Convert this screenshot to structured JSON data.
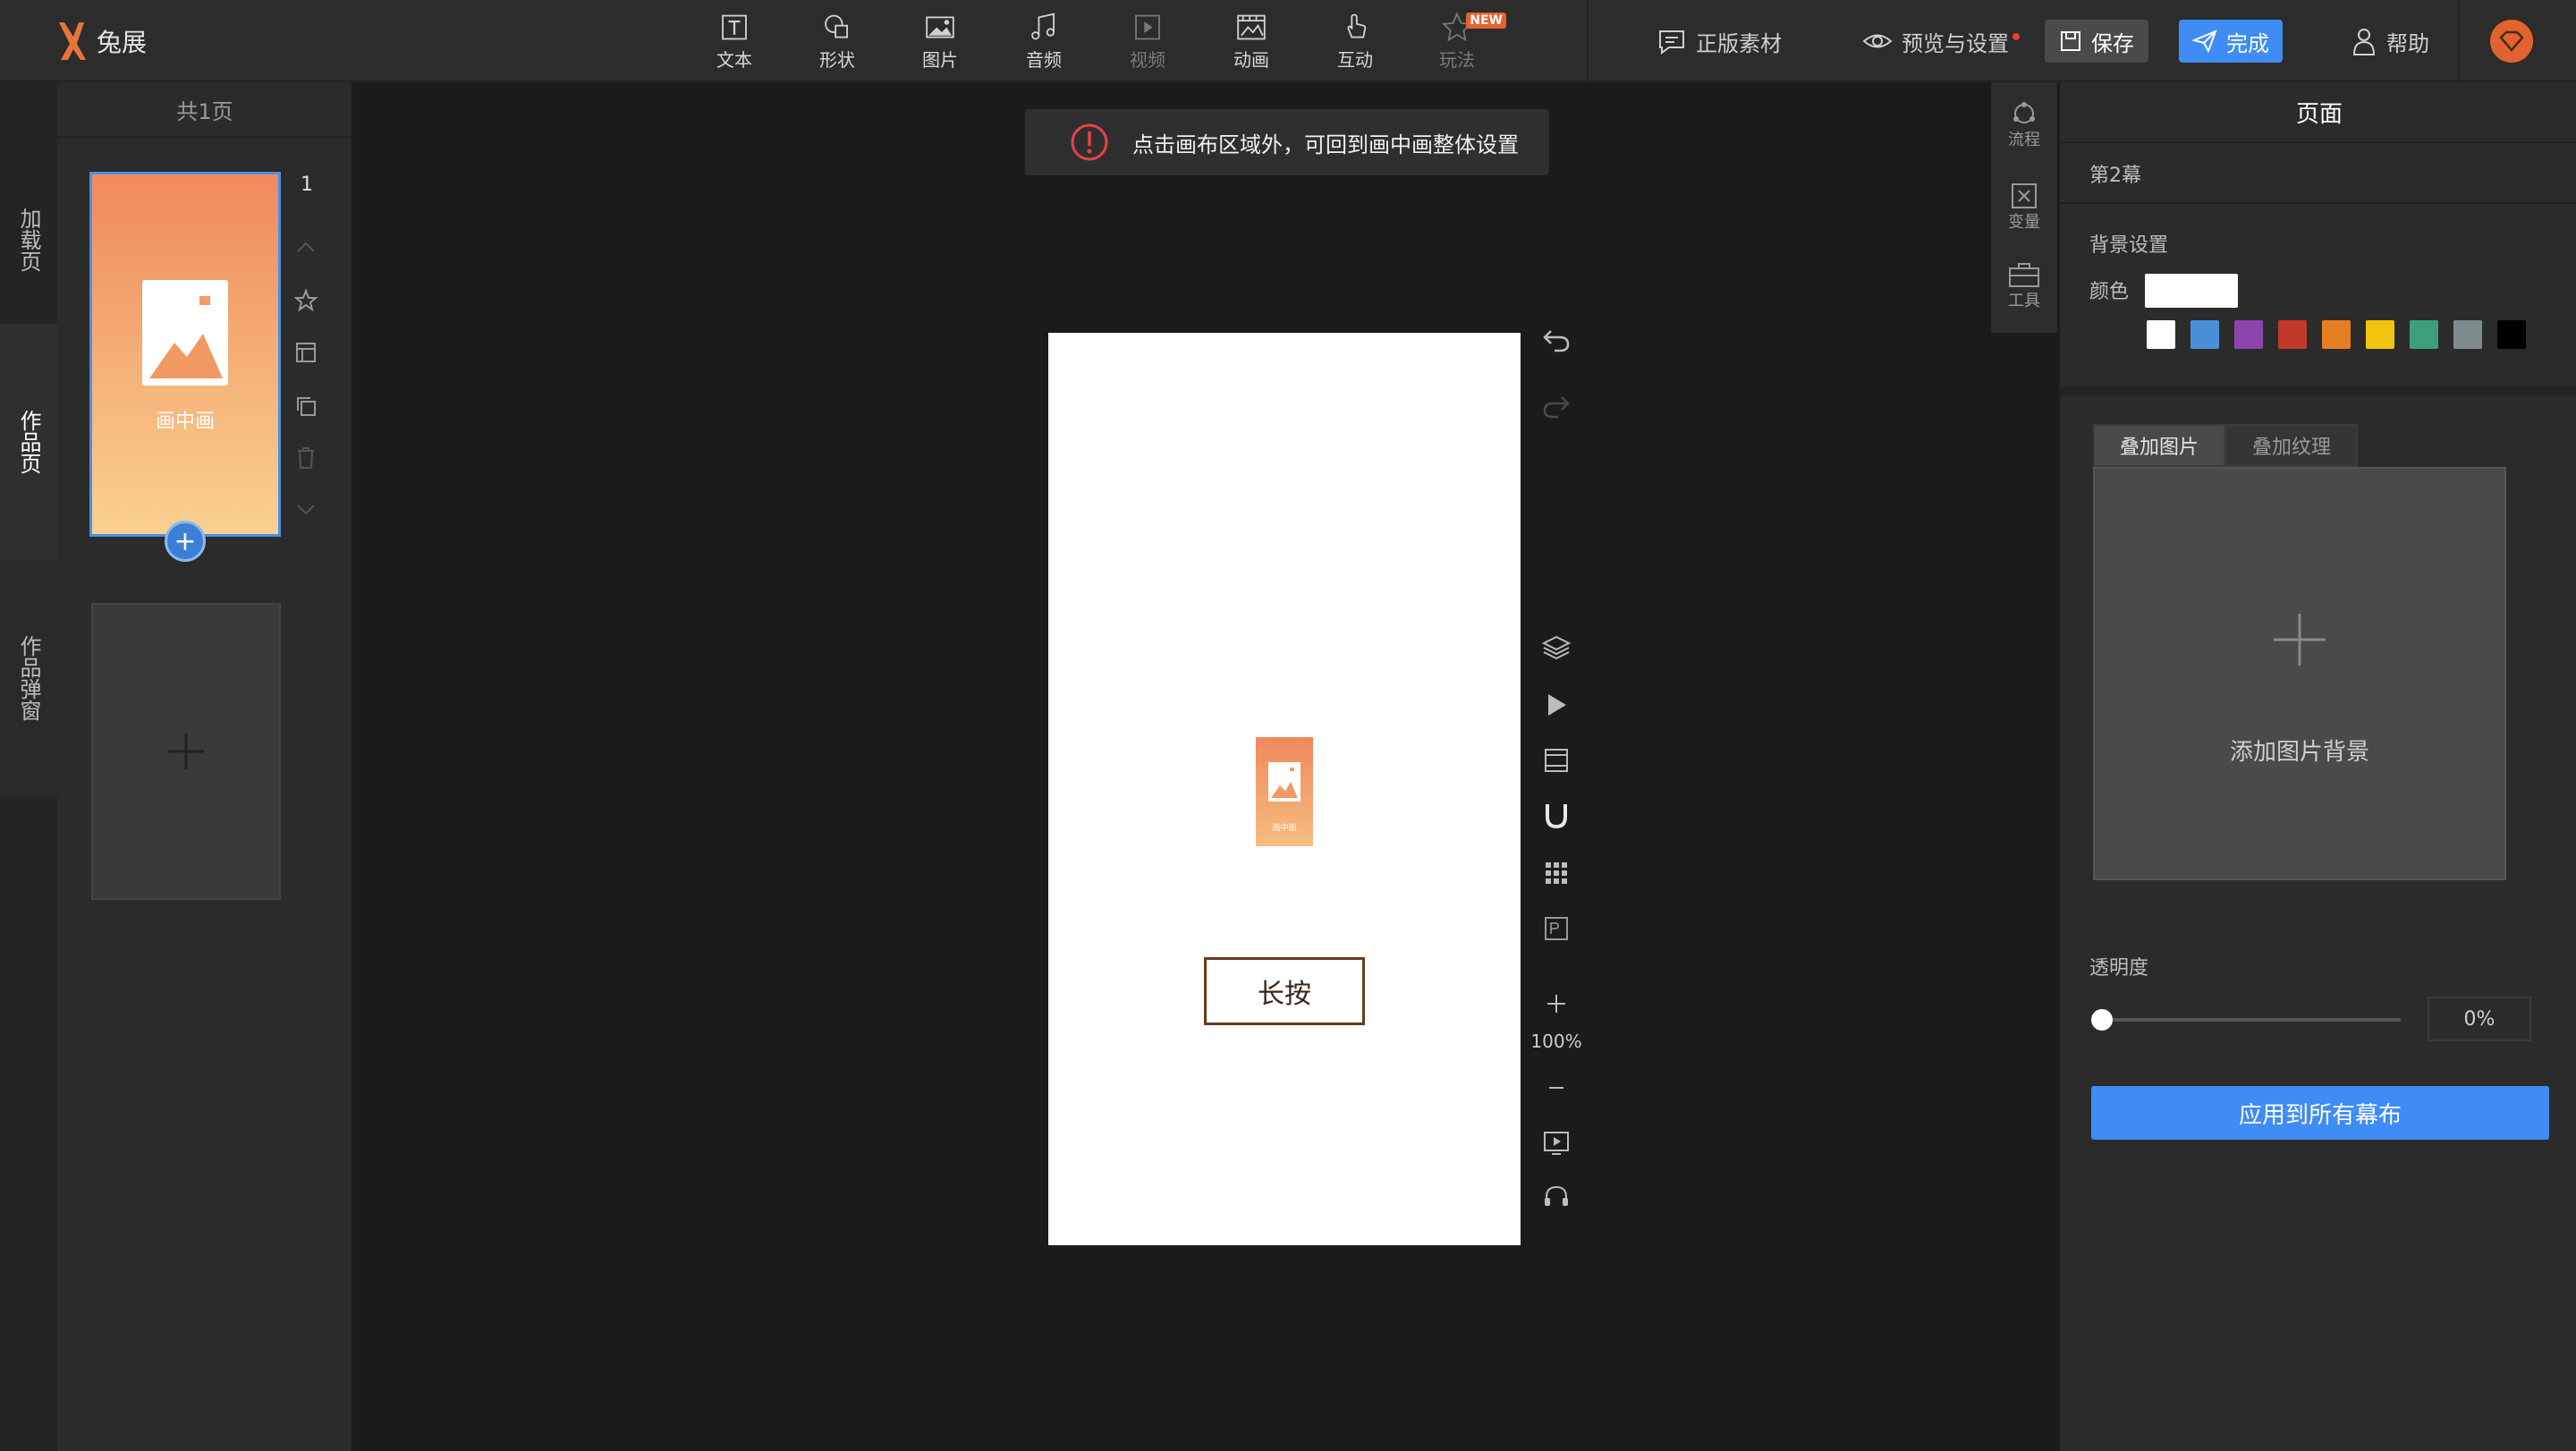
{
  "app": {
    "name": "兔展"
  },
  "toolbar": {
    "tools": [
      {
        "label": "文本",
        "icon": "text-icon"
      },
      {
        "label": "形状",
        "icon": "shape-icon"
      },
      {
        "label": "图片",
        "icon": "image-icon"
      },
      {
        "label": "音频",
        "icon": "audio-icon"
      },
      {
        "label": "视频",
        "icon": "video-icon",
        "disabled": true
      },
      {
        "label": "动画",
        "icon": "animation-icon"
      },
      {
        "label": "互动",
        "icon": "interact-icon"
      },
      {
        "label": "玩法",
        "icon": "play-icon",
        "disabled": true,
        "badge": "NEW"
      }
    ],
    "assets": "正版素材",
    "preview": "预览与设置",
    "save": "保存",
    "done": "完成",
    "help": "帮助"
  },
  "left_tabs": [
    "加载页",
    "作品页",
    "作品弹窗"
  ],
  "left_tab_active": "作品页",
  "page_list": {
    "count_label": "共1页",
    "pages": [
      {
        "number": "1",
        "label": "画中画"
      }
    ]
  },
  "canvas": {
    "tip": "点击画布区域外，可回到画中画整体设置",
    "mini_label": "画中画",
    "button_label": "长按",
    "zoom": "100%"
  },
  "right_mini": [
    "流程",
    "变量",
    "工具"
  ],
  "right_panel": {
    "title": "页面",
    "scene": "第2幕",
    "bg_section": "背景设置",
    "color_label": "颜色",
    "color_value": "#ffffff",
    "swatches": [
      "#ffffff",
      "#4a90d9",
      "#8e44ad",
      "#c0392b",
      "#e67e22",
      "#f1c40f",
      "#3f9e7a",
      "#7f8c8d",
      "#000000"
    ],
    "tabs": [
      "叠加图片",
      "叠加纹理"
    ],
    "active_tab": "叠加图片",
    "upload_label": "添加图片背景",
    "opacity_label": "透明度",
    "opacity_value": "0%",
    "apply_label": "应用到所有幕布"
  }
}
